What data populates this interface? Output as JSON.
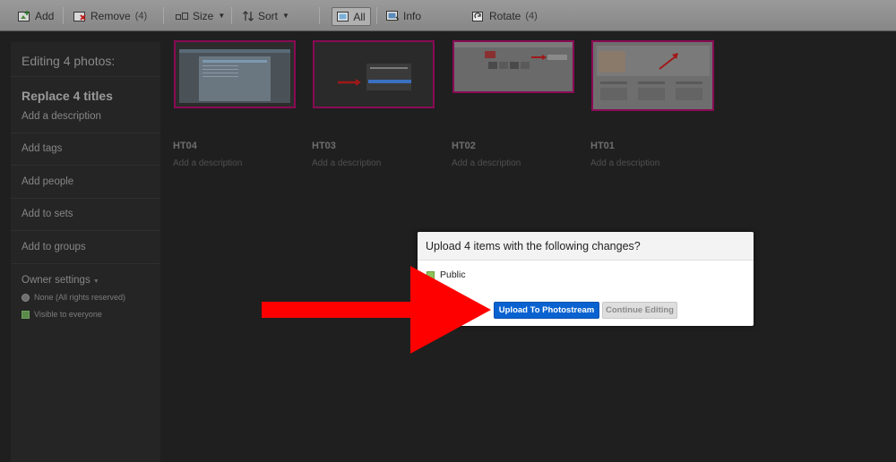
{
  "toolbar": {
    "add_label": "Add",
    "remove_label": "Remove",
    "remove_count": "(4)",
    "size_label": "Size",
    "sort_label": "Sort",
    "all_label": "All",
    "info_label": "Info",
    "rotate_label": "Rotate",
    "rotate_count": "(4)"
  },
  "sidebar": {
    "heading": "Editing 4 photos:",
    "title": "Replace 4 titles",
    "add_description": "Add a description",
    "items": [
      {
        "label": "Add tags"
      },
      {
        "label": "Add people"
      },
      {
        "label": "Add to sets"
      },
      {
        "label": "Add to groups"
      }
    ],
    "owner_settings": "Owner settings",
    "license": "None (All rights reserved)",
    "visibility": "Visible to everyone"
  },
  "photos": [
    {
      "title": "HT04",
      "description": "Add a description"
    },
    {
      "title": "HT03",
      "description": "Add a description"
    },
    {
      "title": "HT02",
      "description": "Add a description"
    },
    {
      "title": "HT01",
      "description": "Add a description"
    }
  ],
  "dialog": {
    "title": "Upload 4 items with the following changes?",
    "privacy_label": "Public",
    "upload_button": "Upload To Photostream",
    "continue_button": "Continue Editing"
  },
  "colors": {
    "upload_button": "#0a62d0",
    "annotation_arrow": "#ff0000",
    "photo_border": "#8a0a55",
    "public_indicator": "#8ec35a"
  }
}
